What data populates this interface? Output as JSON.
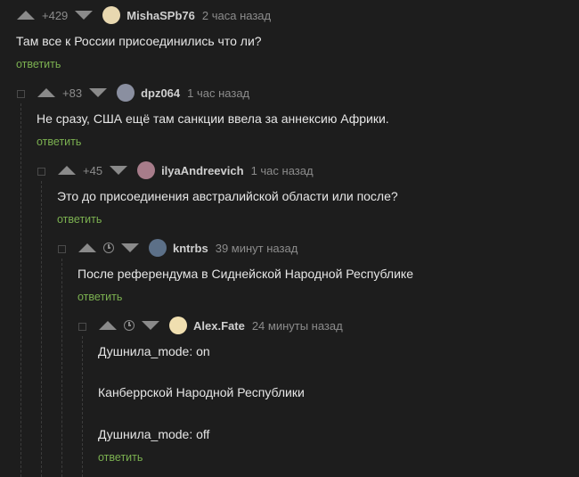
{
  "comments": [
    {
      "rating": "+429",
      "user": "MishaSPb76",
      "time": "2 часа назад",
      "lines": [
        "Там все к России присоединились что ли?"
      ],
      "reply": "ответить",
      "avatar_color": "#e8d8b0"
    },
    {
      "rating": "+83",
      "user": "dpz064",
      "time": "1 час назад",
      "lines": [
        "Не сразу, США ещё там санкции ввела за аннексию Африки."
      ],
      "reply": "ответить",
      "avatar_color": "#8a8fa0"
    },
    {
      "rating": "+45",
      "user": "ilyaAndreevich",
      "time": "1 час назад",
      "lines": [
        "Это до присоединения австралийской области или после?"
      ],
      "reply": "ответить",
      "avatar_color": "#a77c8a"
    },
    {
      "rating": "",
      "user": "kntrbs",
      "time": "39 минут назад",
      "lines": [
        "После референдума в Сиднейской Народной Республике"
      ],
      "reply": "ответить",
      "avatar_color": "#5c7088"
    },
    {
      "rating": "",
      "user": "Alex.Fate",
      "time": "24 минуты назад",
      "lines": [
        "Душнила_mode: on",
        "Канберрской Народной Республики",
        "Душнила_mode: off"
      ],
      "reply": "ответить",
      "avatar_color": "#f0dfb0"
    }
  ]
}
